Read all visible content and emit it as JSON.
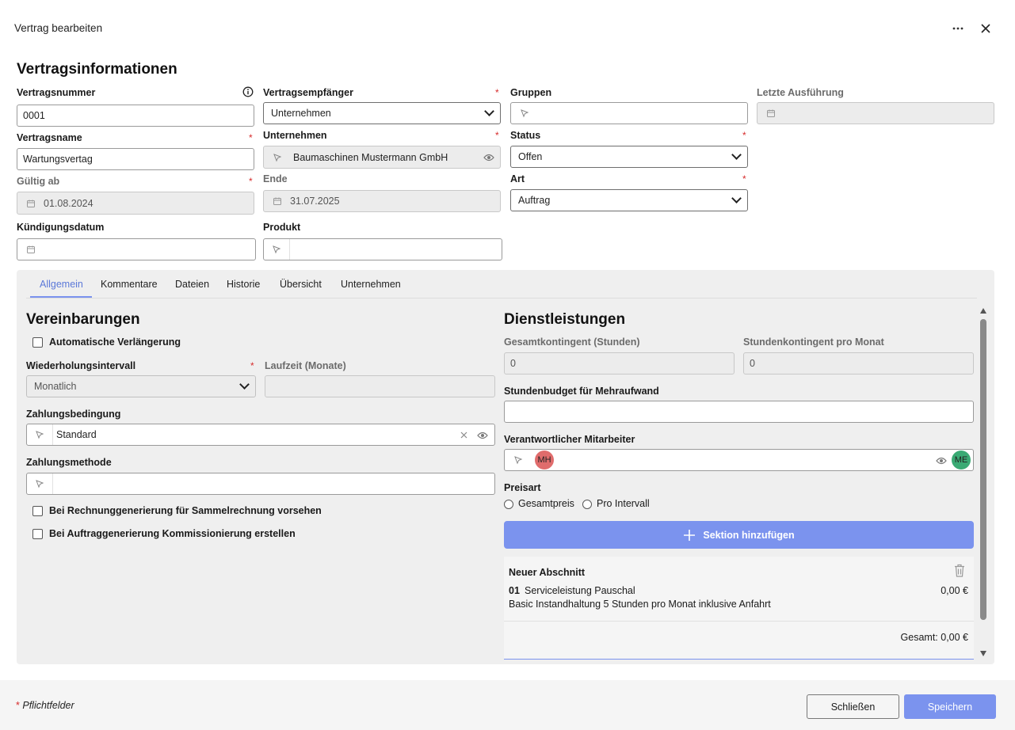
{
  "window": {
    "title": "Vertrag bearbeiten"
  },
  "section_title": "Vertragsinformationen",
  "fields": {
    "vertragsnummer": {
      "label": "Vertragsnummer",
      "value": "0001"
    },
    "vertragsname": {
      "label": "Vertragsname",
      "value": "Wartungsvertag"
    },
    "gueltig_ab": {
      "label": "Gültig ab",
      "value": "01.08.2024"
    },
    "kuendigungsdatum": {
      "label": "Kündigungsdatum",
      "value": ""
    },
    "vertragsempfaenger": {
      "label": "Vertragsempfänger",
      "value": "Unternehmen"
    },
    "unternehmen": {
      "label": "Unternehmen",
      "value": "Baumaschinen Mustermann GmbH"
    },
    "ende": {
      "label": "Ende",
      "value": "31.07.2025"
    },
    "produkt": {
      "label": "Produkt",
      "value": ""
    },
    "gruppen": {
      "label": "Gruppen",
      "value": ""
    },
    "status": {
      "label": "Status",
      "value": "Offen"
    },
    "art": {
      "label": "Art",
      "value": "Auftrag"
    },
    "letzte_ausfuehrung": {
      "label": "Letzte Ausführung",
      "value": ""
    }
  },
  "required_mark": "*",
  "tabs": [
    "Allgemein",
    "Kommentare",
    "Dateien",
    "Historie",
    "Übersicht",
    "Unternehmen"
  ],
  "vereinbarungen": {
    "title": "Vereinbarungen",
    "auto_verlaengerung": "Automatische Verlängerung",
    "wiederholungsintervall": {
      "label": "Wiederholungsintervall",
      "value": "Monatlich"
    },
    "laufzeit": {
      "label": "Laufzeit (Monate)",
      "value": ""
    },
    "zahlungsbedingung": {
      "label": "Zahlungsbedingung",
      "value": "Standard"
    },
    "zahlungsmethode": {
      "label": "Zahlungsmethode",
      "value": ""
    },
    "sammelrechnung": "Bei Rechnunggenerierung für Sammelrechnung vorsehen",
    "kommissionierung": "Bei Auftraggenerierung Kommissionierung erstellen"
  },
  "dienstleistungen": {
    "title": "Dienstleistungen",
    "gesamtkontingent": {
      "label": "Gesamtkontingent (Stunden)",
      "value": "0"
    },
    "stundenkontingent": {
      "label": "Stundenkontingent pro Monat",
      "value": "0"
    },
    "stundenbudget": {
      "label": "Stundenbudget für Mehraufwand",
      "value": ""
    },
    "mitarbeiter": {
      "label": "Verantwortlicher Mitarbeiter",
      "avatar_left": "MH",
      "avatar_right": "ME"
    },
    "preisart": {
      "label": "Preisart",
      "option1": "Gesamtpreis",
      "option2": "Pro Intervall"
    },
    "add_section_button": "Sektion hinzufügen",
    "abschnitt": {
      "title": "Neuer Abschnitt",
      "item_number": "01",
      "item_name": "Serviceleistung Pauschal",
      "item_price": "0,00 €",
      "item_description": "Basic Instandhaltung 5 Stunden pro Monat inklusive Anfahrt",
      "total": "Gesamt: 0,00 €"
    }
  },
  "footer": {
    "required_note": "Pflichtfelder",
    "close_button": "Schließen",
    "save_button": "Speichern"
  },
  "colors": {
    "accent": "#7b93ee",
    "required": "#d62b2b",
    "avatar_mh": "#e06c6c",
    "avatar_me": "#3aaa74"
  },
  "icons": [
    "more-icon",
    "close-icon",
    "info-icon",
    "calendar-icon",
    "pointer-icon",
    "eye-icon",
    "clear-icon",
    "plus-icon",
    "trash-icon"
  ]
}
